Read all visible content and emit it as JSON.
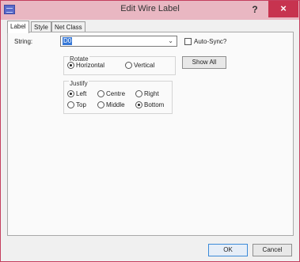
{
  "window": {
    "title": "Edit Wire Label",
    "help_label": "?",
    "close_label": "×"
  },
  "tabs": [
    {
      "label": "Label",
      "active": true
    },
    {
      "label": "Style",
      "active": false
    },
    {
      "label": "Net Class",
      "active": false
    }
  ],
  "label_tab": {
    "string_label": "String:",
    "string_value": "D0",
    "auto_sync_label": "Auto-Sync?",
    "auto_sync_checked": false,
    "show_all_label": "Show All",
    "rotate": {
      "legend": "Rotate",
      "options": [
        {
          "label": "Horizontal",
          "checked": true
        },
        {
          "label": "Vertical",
          "checked": false
        }
      ]
    },
    "justify": {
      "legend": "Justify",
      "options": [
        {
          "label": "Left",
          "checked": true
        },
        {
          "label": "Centre",
          "checked": false
        },
        {
          "label": "Right",
          "checked": false
        },
        {
          "label": "Top",
          "checked": false
        },
        {
          "label": "Middle",
          "checked": false
        },
        {
          "label": "Bottom",
          "checked": true
        }
      ]
    }
  },
  "footer": {
    "ok_label": "OK",
    "cancel_label": "Cancel"
  },
  "colors": {
    "title_bar": "#e9b7c2",
    "close_button": "#c7334f",
    "selection": "#3778d7"
  }
}
